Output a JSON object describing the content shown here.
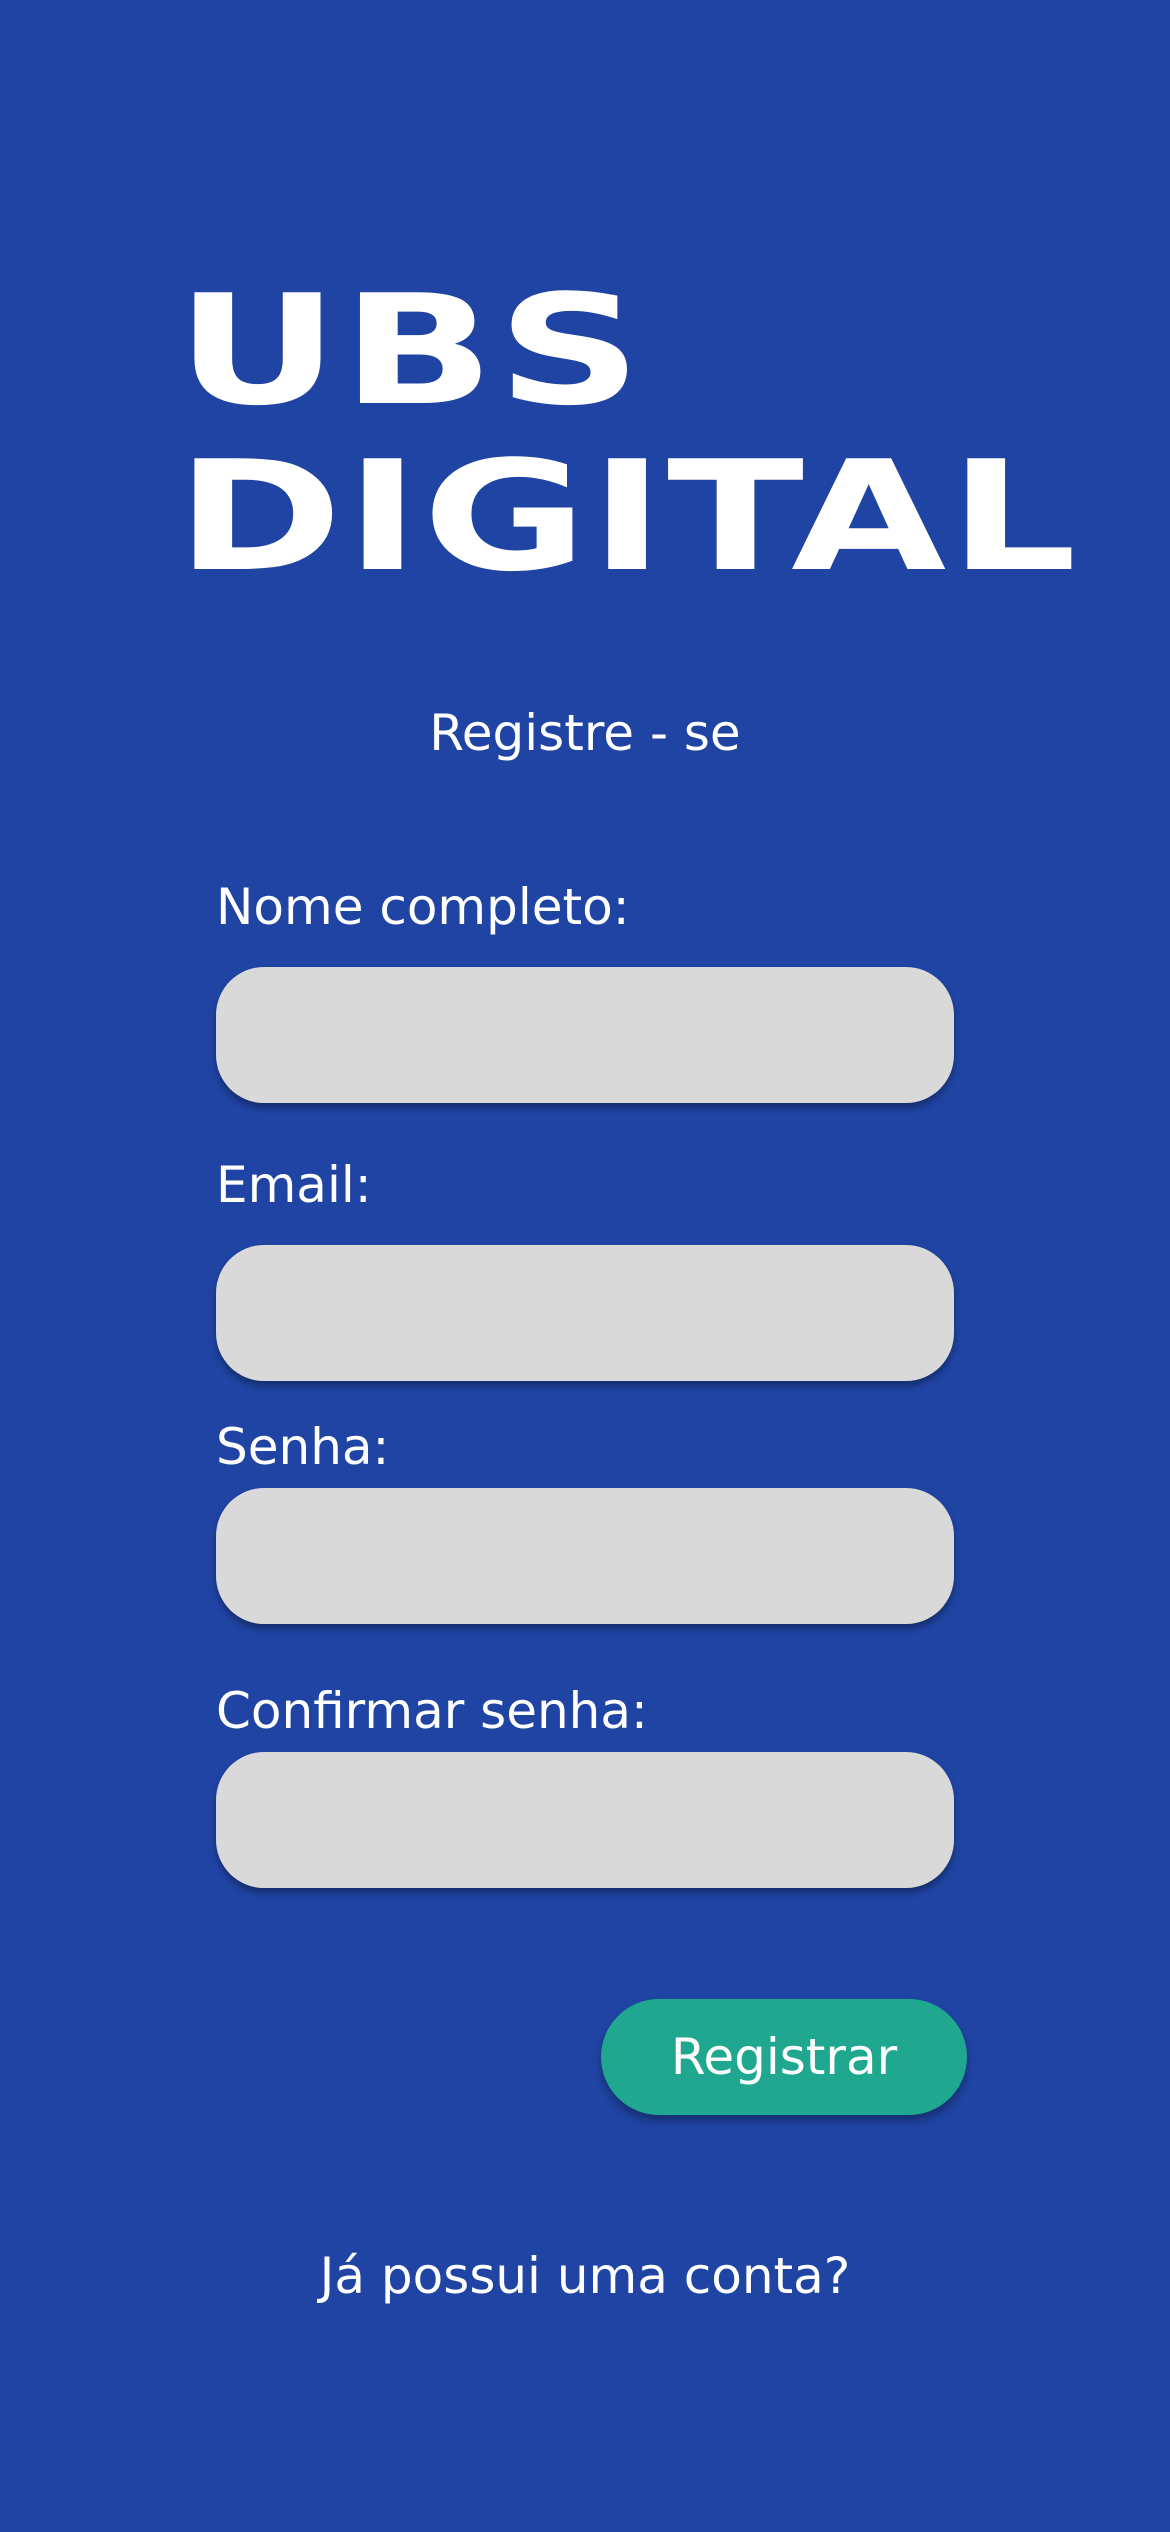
{
  "logo": {
    "line1": "UBS",
    "line2": "DIGITAL"
  },
  "subtitle": "Registre - se",
  "form": {
    "full_name": {
      "label": "Nome completo:",
      "value": "",
      "placeholder": ""
    },
    "email": {
      "label": "Email:",
      "value": "",
      "placeholder": ""
    },
    "password": {
      "label": "Senha:",
      "value": "",
      "placeholder": ""
    },
    "confirm_password": {
      "label": "Confirmar senha:",
      "value": "",
      "placeholder": ""
    }
  },
  "register_button": {
    "label": "Registrar"
  },
  "login_link": {
    "label": "Já possui uma conta?"
  },
  "colors": {
    "background": "#1f44a3",
    "input_background": "#d9d9d9",
    "button_background": "#1fa88f",
    "text": "#ffffff"
  }
}
